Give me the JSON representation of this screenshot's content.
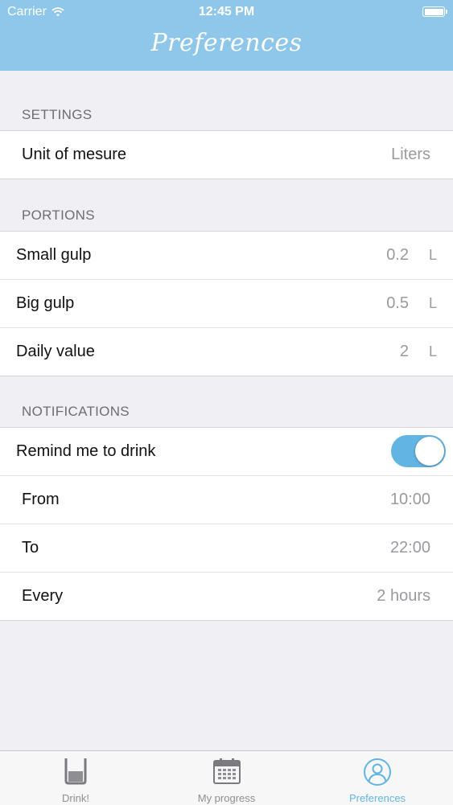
{
  "status_bar": {
    "carrier": "Carrier",
    "time": "12:45 PM"
  },
  "header": {
    "title": "Preferences"
  },
  "settings": {
    "header": "SETTINGS",
    "unit_label": "Unit of mesure",
    "unit_value": "Liters"
  },
  "portions": {
    "header": "PORTIONS",
    "rows": [
      {
        "label": "Small gulp",
        "value": "0.2",
        "unit": "L"
      },
      {
        "label": "Big gulp",
        "value": "0.5",
        "unit": "L"
      },
      {
        "label": "Daily value",
        "value": "2",
        "unit": "L"
      }
    ]
  },
  "notifications": {
    "header": "NOTIFICATIONS",
    "remind_label": "Remind me to drink",
    "remind_enabled": true,
    "from_label": "From",
    "from_value": "10:00",
    "to_label": "To",
    "to_value": "22:00",
    "every_label": "Every",
    "every_value": "2 hours"
  },
  "tabbar": {
    "tabs": [
      {
        "label": "Drink!",
        "icon": "glass-icon"
      },
      {
        "label": "My progress",
        "icon": "calendar-icon"
      },
      {
        "label": "Preferences",
        "icon": "user-icon",
        "active": true
      }
    ]
  },
  "colors": {
    "accent": "#8ec7ea",
    "toggle": "#62b5e3",
    "background": "#efeff4"
  }
}
